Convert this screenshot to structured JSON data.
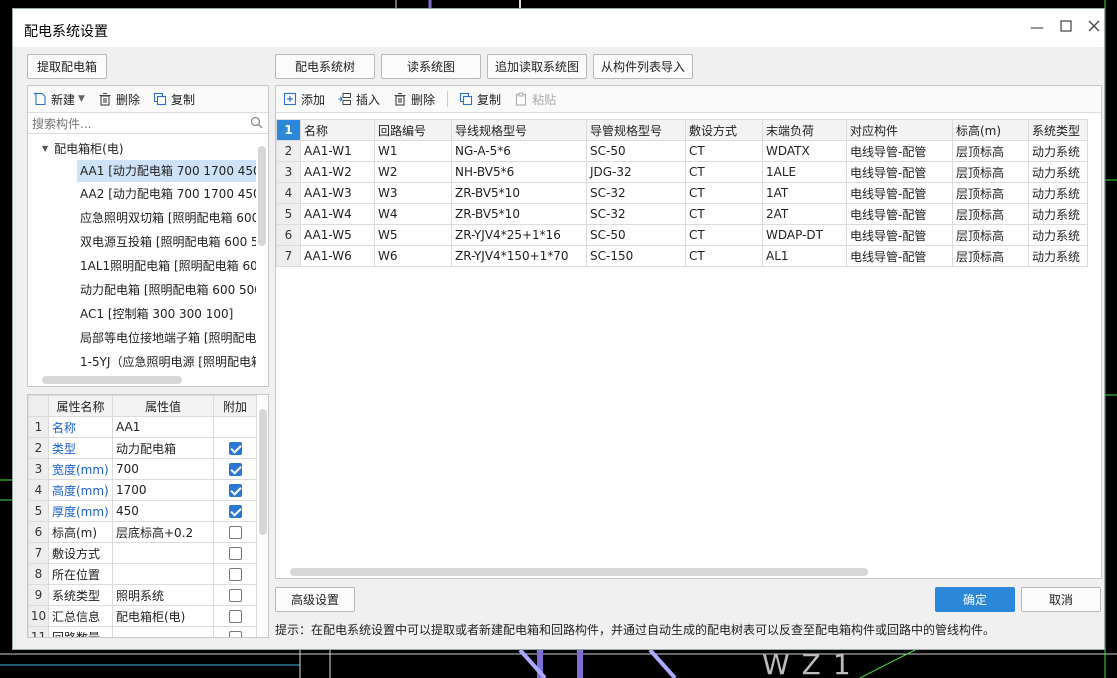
{
  "window": {
    "title": "配电系统设置"
  },
  "left": {
    "extract_button": "提取配电箱",
    "toolbar": {
      "new": "新建",
      "delete": "删除",
      "copy": "复制"
    },
    "search": {
      "placeholder": "搜索构件..."
    },
    "tree": {
      "root": "配电箱柜(电)",
      "items": [
        "AA1 [动力配电箱 700 1700 450]",
        "AA2 [动力配电箱 700 1700 450]",
        "应急照明双切箱 [照明配电箱 600",
        "双电源互投箱 [照明配电箱 600 5",
        "1AL1照明配电箱 [照明配电箱 60",
        "动力配电箱 [照明配电箱 600 500",
        "AC1 [控制箱 300 300 100]",
        "局部等电位接地端子箱 [照明配电",
        "1-5YJ（应急照明电源 [照明配电箱"
      ]
    },
    "props": {
      "headers": [
        "属性名称",
        "属性值",
        "附加"
      ],
      "rows": [
        {
          "no": "1",
          "name": "名称",
          "value": "AA1",
          "check": null,
          "blue": true
        },
        {
          "no": "2",
          "name": "类型",
          "value": "动力配电箱",
          "check": true,
          "blue": true
        },
        {
          "no": "3",
          "name": "宽度(mm)",
          "value": "700",
          "check": true,
          "blue": true
        },
        {
          "no": "4",
          "name": "高度(mm)",
          "value": "1700",
          "check": true,
          "blue": true
        },
        {
          "no": "5",
          "name": "厚度(mm)",
          "value": "450",
          "check": true,
          "blue": true
        },
        {
          "no": "6",
          "name": "标高(m)",
          "value": "层底标高+0.2",
          "check": false,
          "blue": false
        },
        {
          "no": "7",
          "name": "敷设方式",
          "value": "",
          "check": false,
          "blue": false
        },
        {
          "no": "8",
          "name": "所在位置",
          "value": "",
          "check": false,
          "blue": false
        },
        {
          "no": "9",
          "name": "系统类型",
          "value": "照明系统",
          "check": false,
          "blue": false
        },
        {
          "no": "10",
          "name": "汇总信息",
          "value": "配电箱柜(电)",
          "check": false,
          "blue": false
        },
        {
          "no": "11",
          "name": "回路数量",
          "value": "",
          "check": false,
          "blue": false
        }
      ]
    }
  },
  "top_buttons": [
    "配电系统树",
    "读系统图",
    "追加读取系统图",
    "从构件列表导入"
  ],
  "grid": {
    "toolbar": {
      "add": "添加",
      "insert": "插入",
      "delete": "删除",
      "copy": "复制",
      "paste": "粘贴"
    },
    "header_no": "1",
    "columns": [
      "名称",
      "回路编号",
      "导线规格型号",
      "导管规格型号",
      "敷设方式",
      "末端负荷",
      "对应构件",
      "标高(m)",
      "系统类型"
    ],
    "rows": [
      {
        "no": "2",
        "cells": [
          "AA1-W1",
          "W1",
          "NG-A-5*6",
          "SC-50",
          "CT",
          "WDATX",
          "电线导管-配管",
          "层顶标高",
          "动力系统"
        ]
      },
      {
        "no": "3",
        "cells": [
          "AA1-W2",
          "W2",
          "NH-BV5*6",
          "JDG-32",
          "CT",
          "1ALE",
          "电线导管-配管",
          "层顶标高",
          "动力系统"
        ]
      },
      {
        "no": "4",
        "cells": [
          "AA1-W3",
          "W3",
          "ZR-BV5*10",
          "SC-32",
          "CT",
          "1AT",
          "电线导管-配管",
          "层顶标高",
          "动力系统"
        ]
      },
      {
        "no": "5",
        "cells": [
          "AA1-W4",
          "W4",
          "ZR-BV5*10",
          "SC-32",
          "CT",
          "2AT",
          "电线导管-配管",
          "层顶标高",
          "动力系统"
        ]
      },
      {
        "no": "6",
        "cells": [
          "AA1-W5",
          "W5",
          "ZR-YJV4*25+1*16",
          "SC-50",
          "CT",
          "WDAP-DT",
          "电线导管-配管",
          "层顶标高",
          "动力系统"
        ]
      },
      {
        "no": "7",
        "cells": [
          "AA1-W6",
          "W6",
          "ZR-YJV4*150+1*70",
          "SC-150",
          "CT",
          "AL1",
          "电线导管-配管",
          "层顶标高",
          "动力系统"
        ]
      }
    ]
  },
  "footer": {
    "advanced": "高级设置",
    "ok": "确定",
    "cancel": "取消",
    "hint": "提示：在配电系统设置中可以提取或者新建配电箱和回路构件，并通过自动生成的配电树表可以反查至配电箱构件或回路中的管线构件。"
  },
  "background": {
    "cad_text": "WZ1"
  },
  "colors": {
    "accent": "#2b88d8",
    "cad_background": "#000000",
    "selection": "#cde3f5",
    "prop_label": "#1a5fd1"
  }
}
